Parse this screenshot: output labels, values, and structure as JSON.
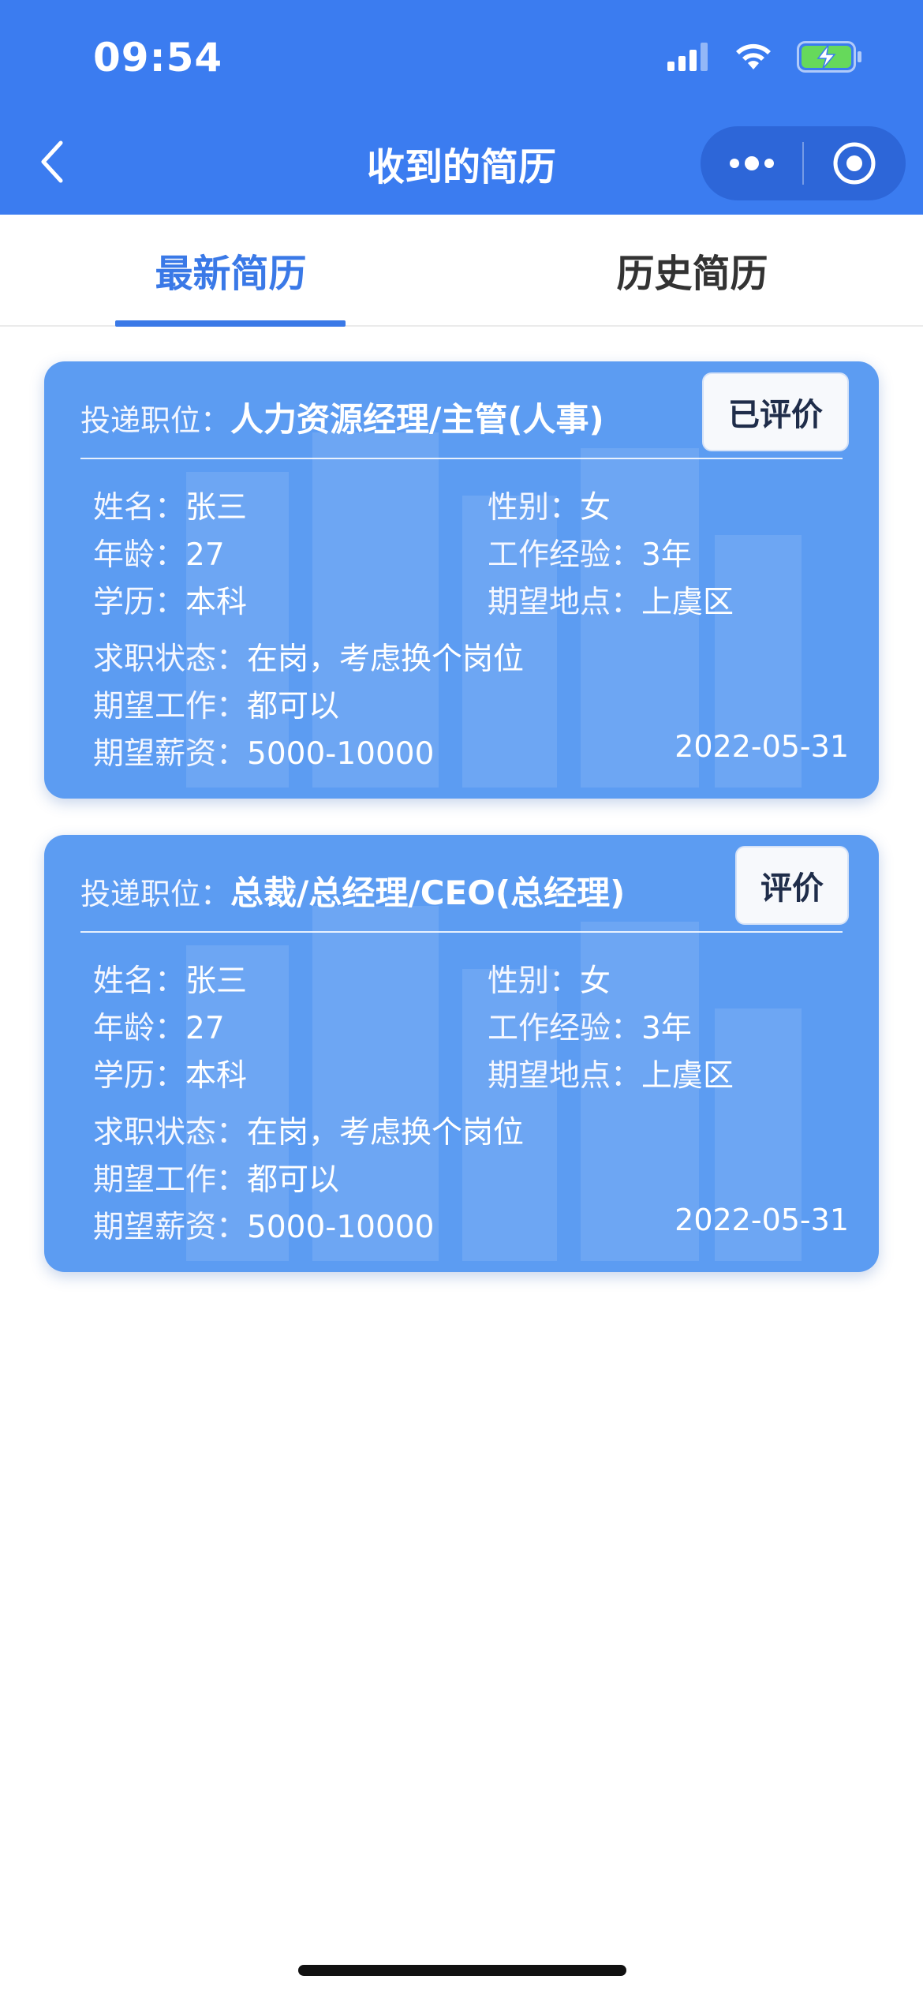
{
  "status_bar": {
    "time": "09:54",
    "icons": [
      "signal-icon",
      "wifi-icon",
      "battery-charging-icon"
    ]
  },
  "nav": {
    "title": "收到的简历",
    "back_icon": "chevron-left-icon",
    "more_icon": "more-dots-icon",
    "target_icon": "close-target-icon"
  },
  "tabs": {
    "items": [
      {
        "label": "最新简历",
        "active": true
      },
      {
        "label": "历史简历",
        "active": false
      }
    ],
    "active_color": "#3a79e7"
  },
  "cards": [
    {
      "position_label": "投递职位：",
      "position_value": "人力资源经理/主管(人事)",
      "eval_label": "已评价",
      "fields": {
        "name": {
          "k": "姓名：",
          "v": "张三"
        },
        "gender": {
          "k": "性别：",
          "v": "女"
        },
        "age": {
          "k": "年龄：",
          "v": "27"
        },
        "experience": {
          "k": "工作经验：",
          "v": "3年"
        },
        "education": {
          "k": "学历：",
          "v": "本科"
        },
        "location": {
          "k": "期望地点：",
          "v": "上虞区"
        },
        "status": {
          "k": "求职状态：",
          "v": "在岗，考虑换个岗位"
        },
        "job": {
          "k": "期望工作：",
          "v": "都可以"
        },
        "salary": {
          "k": "期望薪资：",
          "v": "5000-10000"
        }
      },
      "date": "2022-05-31"
    },
    {
      "position_label": "投递职位：",
      "position_value": "总裁/总经理/CEO(总经理)",
      "eval_label": "评价",
      "fields": {
        "name": {
          "k": "姓名：",
          "v": "张三"
        },
        "gender": {
          "k": "性别：",
          "v": "女"
        },
        "age": {
          "k": "年龄：",
          "v": "27"
        },
        "experience": {
          "k": "工作经验：",
          "v": "3年"
        },
        "education": {
          "k": "学历：",
          "v": "本科"
        },
        "location": {
          "k": "期望地点：",
          "v": "上虞区"
        },
        "status": {
          "k": "求职状态：",
          "v": "在岗，考虑换个岗位"
        },
        "job": {
          "k": "期望工作：",
          "v": "都可以"
        },
        "salary": {
          "k": "期望薪资：",
          "v": "5000-10000"
        }
      },
      "date": "2022-05-31"
    }
  ],
  "colors": {
    "header": "#3b7cf0",
    "card": "#5c9cf2",
    "accent": "#3a79e7"
  }
}
